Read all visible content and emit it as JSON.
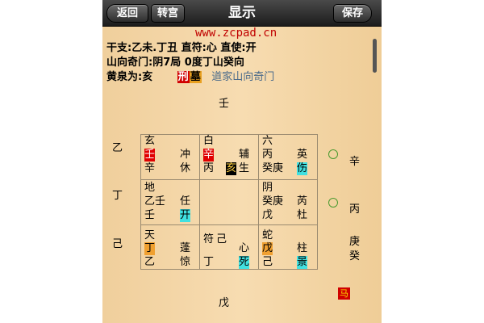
{
  "nav": {
    "back": "返回",
    "switch": "转宫",
    "title": "显示",
    "save": "保存"
  },
  "watermark": "www.zcpad.cn",
  "info": {
    "line1": "干支:乙未.丁丑   直符:心   直使:开",
    "line2": "山向奇门:阴7局   0度丁山癸向",
    "line3_label": "黄泉为:亥",
    "tag1": "刑",
    "tag2": "墓",
    "link": "道家山向奇门"
  },
  "top": "壬",
  "bottom": "戊",
  "left": [
    "乙",
    "丁",
    "己"
  ],
  "right": [
    "辛",
    "丙",
    "庚",
    "癸"
  ],
  "horse": "马",
  "cells": {
    "c00": {
      "a": "玄",
      "b": "壬",
      "c": "冲",
      "d": "辛",
      "e": "休"
    },
    "c01": {
      "a": "白",
      "b": "辛",
      "c": "辅",
      "d": "丙",
      "e": "亥",
      "f": "生"
    },
    "c02": {
      "a": "六",
      "b": "丙",
      "c": "英",
      "d": "癸庚",
      "e": "伤"
    },
    "c10": {
      "a": "地",
      "b": "乙壬",
      "c": "任",
      "d": "壬",
      "e": "开"
    },
    "c12": {
      "a": "阴",
      "b": "癸庚",
      "c": "芮",
      "d": "戊",
      "e": "杜"
    },
    "c20": {
      "a": "天",
      "b": "丁",
      "c": "蓬",
      "d": "乙",
      "e": "惊"
    },
    "c21": {
      "a": "符",
      "b": "己",
      "c": "心",
      "d": "丁",
      "e": "死"
    },
    "c22": {
      "a": "蛇",
      "b": "戊",
      "c": "柱",
      "d": "己",
      "e": "景"
    }
  }
}
